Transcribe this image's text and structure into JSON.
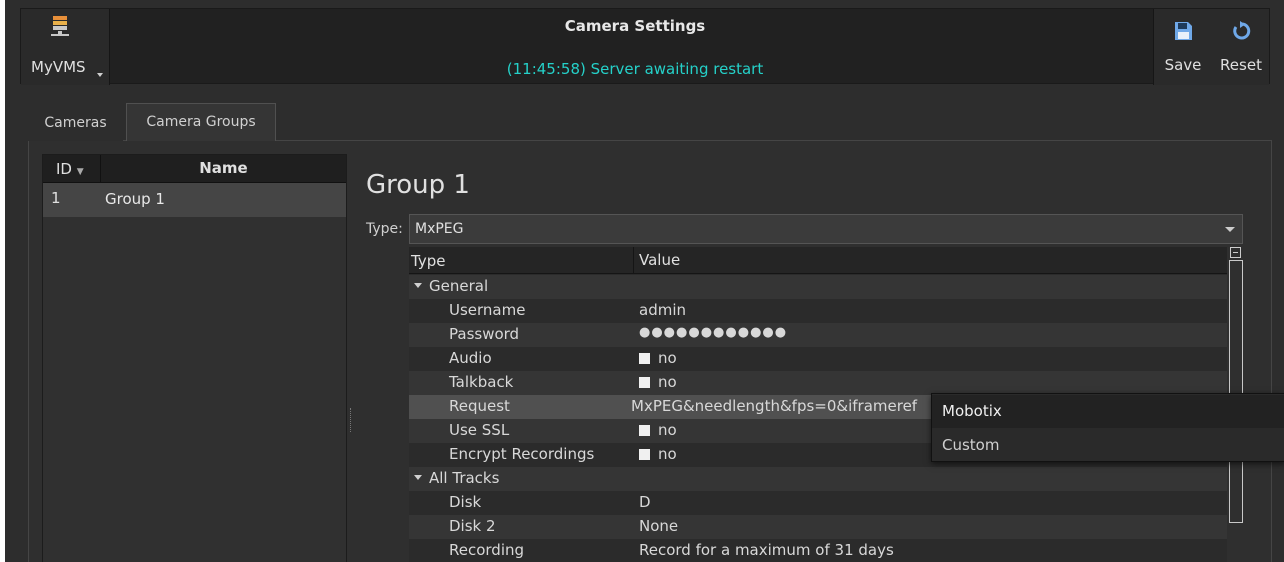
{
  "app": {
    "name": "MyVMS",
    "logo_icon": "server-stack-icon"
  },
  "window": {
    "title": "Camera Settings",
    "status": "(11:45:58) Server awaiting restart",
    "status_color": "#25d1c9"
  },
  "toolbar": {
    "save_label": "Save",
    "save_icon": "floppy-disk-icon",
    "reset_label": "Reset",
    "reset_icon": "reset-arrow-icon",
    "icon_color": "#6fa8e8"
  },
  "tabs": [
    {
      "label": "Cameras"
    },
    {
      "label": "Camera Groups",
      "active": true
    }
  ],
  "group_list": {
    "columns": {
      "id": "ID",
      "name": "Name"
    },
    "sort_indicator": "chevron-down-icon",
    "rows": [
      {
        "id": "1",
        "name": "Group 1",
        "selected": true
      }
    ]
  },
  "detail": {
    "title": "Group 1",
    "type_label": "Type:",
    "type_value": "MxPEG",
    "tree_columns": {
      "type": "Type",
      "value": "Value"
    },
    "sections": [
      {
        "label": "General",
        "rows": [
          {
            "name": "Username",
            "value": "admin"
          },
          {
            "name": "Password",
            "value": "●●●●●●●●●●●●"
          },
          {
            "name": "Audio",
            "value": "no",
            "checkbox": true
          },
          {
            "name": "Talkback",
            "value": "no",
            "checkbox": true
          },
          {
            "name": "Request",
            "value": "MxPEG&needlength&fps=0&iframeref",
            "highlighted": true
          },
          {
            "name": "Use SSL",
            "value": "no",
            "checkbox": true
          },
          {
            "name": "Encrypt Recordings",
            "value": "no",
            "checkbox": true
          }
        ]
      },
      {
        "label": "All Tracks",
        "rows": [
          {
            "name": "Disk",
            "value": "D"
          },
          {
            "name": "Disk 2",
            "value": "None"
          },
          {
            "name": "Recording",
            "value": "Record for a maximum of 31 days"
          }
        ]
      }
    ]
  },
  "request_popup": {
    "options": [
      "Mobotix",
      "Custom"
    ],
    "highlighted": "Mobotix"
  }
}
